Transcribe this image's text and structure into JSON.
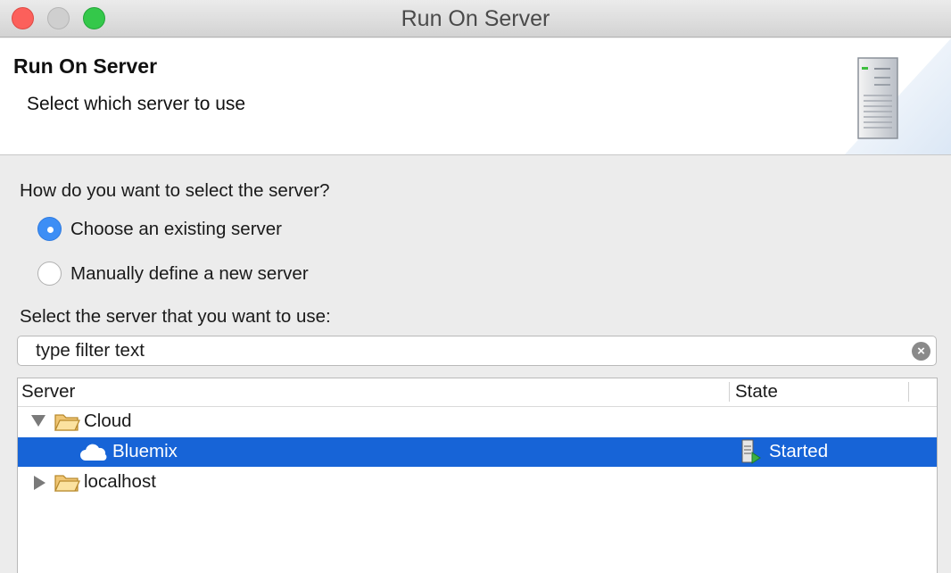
{
  "window": {
    "title": "Run On Server"
  },
  "banner": {
    "title": "Run On Server",
    "subtitle": "Select which server to use",
    "icon": "server-tower-icon"
  },
  "selection": {
    "question": "How do you want to select the server?",
    "options": [
      {
        "label": "Choose an existing server",
        "checked": true
      },
      {
        "label": "Manually define a new server",
        "checked": false
      }
    ],
    "list_label": "Select the server that you want to use:"
  },
  "filter": {
    "placeholder": "type filter text",
    "value": "",
    "clear_icon": "clear-icon"
  },
  "table": {
    "columns": [
      "Server",
      "State"
    ],
    "rows": [
      {
        "label": "Cloud",
        "icon": "folder-icon",
        "expanded": true,
        "state": ""
      },
      {
        "label": "Bluemix",
        "icon": "cloud-icon",
        "selected": true,
        "state": "Started",
        "state_icon": "server-started-icon"
      },
      {
        "label": "localhost",
        "icon": "folder-icon",
        "expanded": false,
        "state": ""
      }
    ]
  },
  "colors": {
    "selection": "#1764d7",
    "radio_checked": "#3d8ef5",
    "close": "#fc605b",
    "zoom": "#34c84a"
  }
}
